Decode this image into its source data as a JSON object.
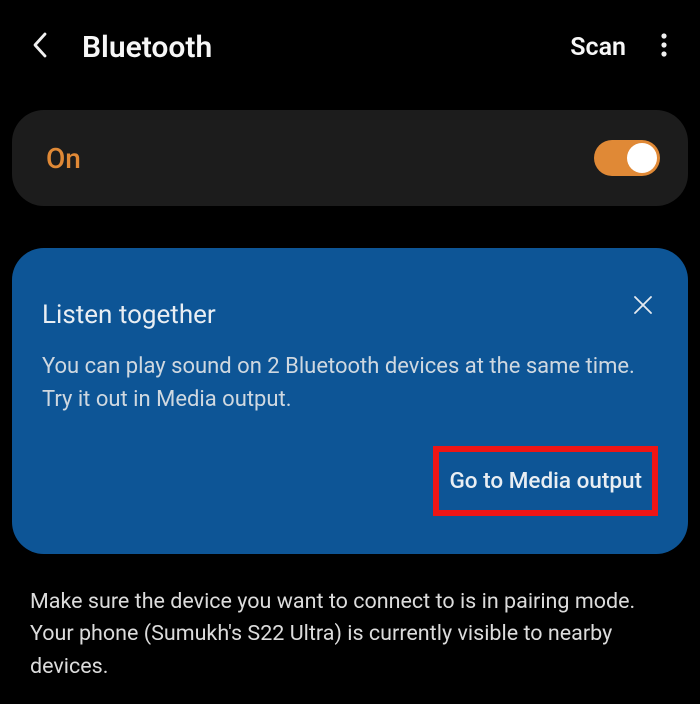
{
  "header": {
    "title": "Bluetooth",
    "scan_label": "Scan"
  },
  "toggle": {
    "label": "On",
    "state": true
  },
  "info_card": {
    "title": "Listen together",
    "body": "You can play sound on 2 Bluetooth devices at the same time. Try it out in Media output.",
    "action_label": "Go to Media output"
  },
  "footer": {
    "text": "Make sure the device you want to connect to is in pairing mode. Your phone (Sumukh's S22 Ultra) is currently visible to nearby devices."
  },
  "colors": {
    "accent": "#e08936",
    "card_blue": "#0d5596",
    "highlight_red": "#ee1515"
  }
}
